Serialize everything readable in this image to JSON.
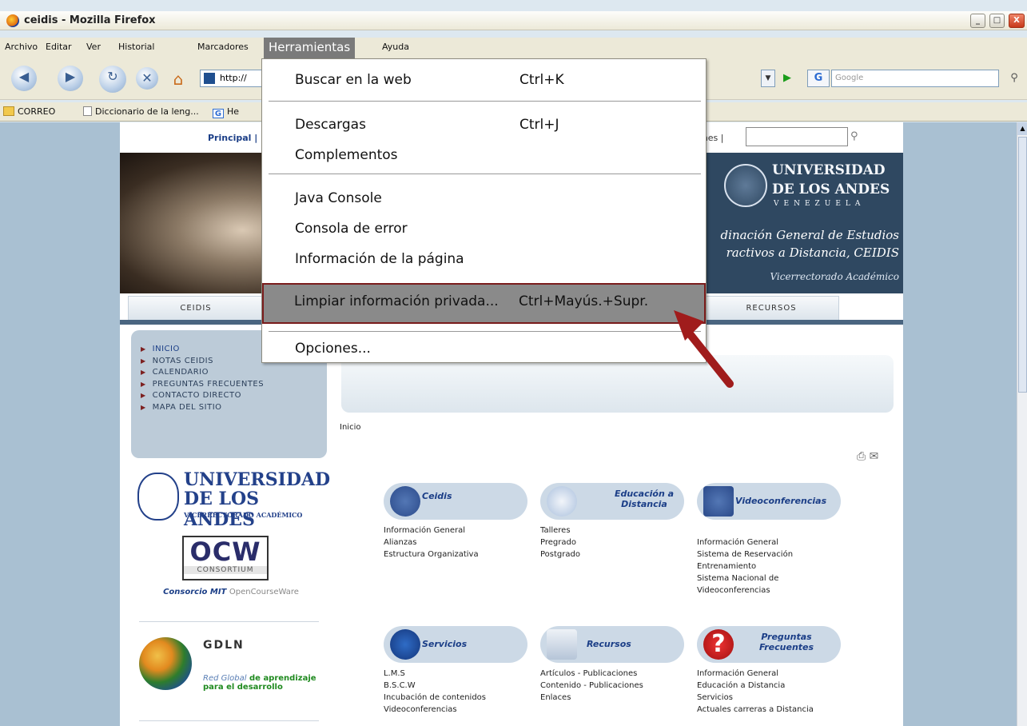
{
  "window": {
    "title": "ceidis - Mozilla Firefox",
    "min": "_",
    "max": "□",
    "close": "X"
  },
  "menubar": [
    "Archivo",
    "Editar",
    "Ver",
    "Historial",
    "Marcadores",
    "Herramientas",
    "Ayuda"
  ],
  "navbar": {
    "url": "http://",
    "search_placeholder": "Google",
    "g_label": "G"
  },
  "bookmarks": [
    "CORREO",
    "Diccionario de la leng...",
    "He"
  ],
  "page": {
    "topnav_left": "Principal |",
    "topnav_right": "enes |",
    "uni_line1": "UNIVERSIDAD",
    "uni_line2": "DE LOS ANDES",
    "uni_line3": "VENEZUELA",
    "coord_line1": "dinación General de Estudios",
    "coord_line2": "ractivos a Distancia, CEIDIS",
    "vicerrectorado": "Vicerrectorado Académico",
    "tabs": [
      "CEIDIS",
      "RECURSOS"
    ],
    "sidenav": [
      "INICIO",
      "NOTAS CEIDIS",
      "CALENDARIO",
      "PREGUNTAS FRECUENTES",
      "CONTACTO DIRECTO",
      "MAPA DEL SITIO"
    ],
    "left_logo": {
      "l1": "UNIVERSIDAD",
      "l2": "DE LOS ANDES",
      "l3": "VICERRECTORADO ACADÉMICO"
    },
    "ocw": {
      "big": "OCW",
      "small": "CONSORTIUM",
      "caption_main": "Consorcio MIT",
      "caption_rest": "OpenCourseWare"
    },
    "gdln": {
      "title": "GDLN",
      "sub_italic": "Red Global",
      "sub_bold": "de aprendizaje para el desarrollo"
    },
    "breadcrumb": "Inicio",
    "cards": [
      {
        "title": "Ceidis",
        "links": [
          "Información General",
          "Alianzas",
          "Estructura Organizativa"
        ]
      },
      {
        "title": "Educación a Distancia",
        "links": [
          "Talleres",
          "Pregrado",
          "Postgrado"
        ]
      },
      {
        "title": "Videoconferencias",
        "links": [
          "Información General",
          "Sistema de Reservación",
          "Entrenamiento",
          "Sistema Nacional de",
          "Videoconferencias"
        ]
      },
      {
        "title": "Servicios",
        "links": [
          "L.M.S",
          "B.S.C.W",
          "Incubación de contenidos",
          "Videoconferencias"
        ]
      },
      {
        "title": "Recursos",
        "links": [
          "Artículos - Publicaciones",
          "Contenido - Publicaciones",
          "Enlaces"
        ]
      },
      {
        "title": "Preguntas Frecuentes",
        "links": [
          "Información General",
          "Educación a Distancia",
          "Servicios",
          "Actuales carreras a Distancia"
        ]
      }
    ]
  },
  "dropdown": {
    "items": [
      {
        "label": "Buscar en la web",
        "shortcut": "Ctrl+K"
      },
      {
        "label": "Descargas",
        "shortcut": "Ctrl+J"
      },
      {
        "label": "Complementos",
        "shortcut": ""
      },
      {
        "label": "Java Console",
        "shortcut": ""
      },
      {
        "label": "Consola de error",
        "shortcut": ""
      },
      {
        "label": "Información de la página",
        "shortcut": ""
      },
      {
        "label": "Limpiar información privada...",
        "shortcut": "Ctrl+Mayús.+Supr."
      },
      {
        "label": "Opciones...",
        "shortcut": ""
      }
    ],
    "highlighted": "Limpiar información privada..."
  },
  "colors": {
    "menu_highlight": "#8a8a8a",
    "arrow": "#a01c1c",
    "banner": "#2f4861"
  }
}
